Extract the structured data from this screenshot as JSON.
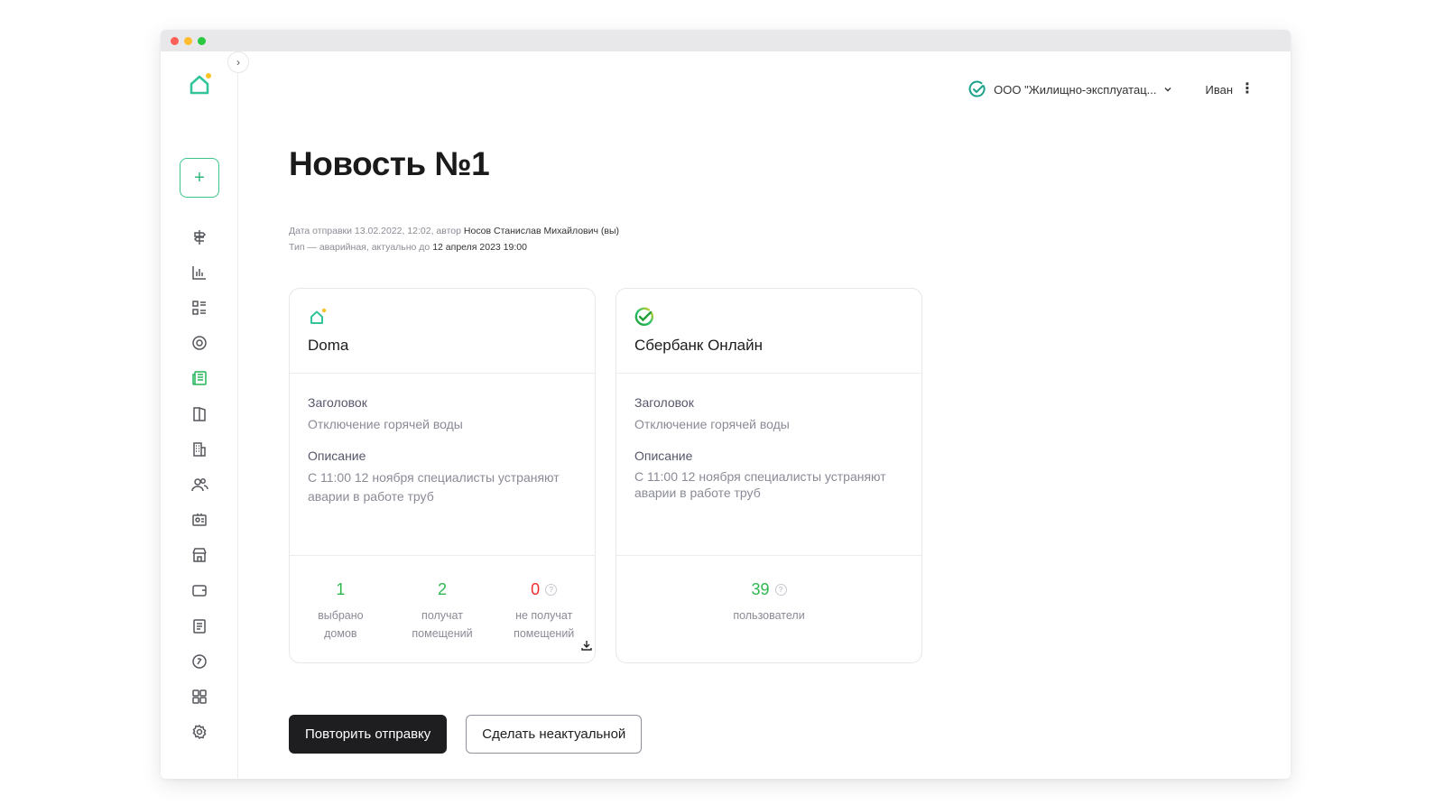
{
  "header": {
    "org_name": "ООО \"Жилищно-эксплуатац...",
    "user_name": "Иван"
  },
  "page": {
    "title": "Новость №1",
    "meta_line1_prefix": "Дата отправки 13.02.2022, 12:02, автор",
    "meta_line1_author": "Носов Станислав Михайлович (вы)",
    "meta_line2_prefix": "Тип — аварийная, актуально до",
    "meta_line2_date": "12 апреля 2023 19:00"
  },
  "cards": [
    {
      "channel": "Doma",
      "heading_label": "Заголовок",
      "heading_value": "Отключение горячей воды",
      "desc_label": "Описание",
      "desc_value": "С 11:00 12 ноября специалисты устраняют аварии в работе труб",
      "stats": [
        {
          "value": "1",
          "caption": "выбрано домов",
          "color": "#2db84f"
        },
        {
          "value": "2",
          "caption": "получат помещений",
          "color": "#2db84f"
        },
        {
          "value": "0",
          "caption": "не получат помещений",
          "color": "#f02d2d"
        }
      ]
    },
    {
      "channel": "Сбербанк Онлайн",
      "heading_label": "Заголовок",
      "heading_value": "Отключение горячей воды",
      "desc_label": "Описание",
      "desc_value": "С 11:00 12 ноября специалисты устраняют аварии в работе труб",
      "stats": [
        {
          "value": "39",
          "caption": "пользователи",
          "color": "#2db84f"
        }
      ]
    }
  ],
  "actions": {
    "resend_label": "Повторить отправку",
    "deactivate_label": "Сделать неактуальной"
  },
  "colors": {
    "accent_green": "#22b556",
    "danger_red": "#f02d2d",
    "logo_dot": "#f7c325"
  }
}
